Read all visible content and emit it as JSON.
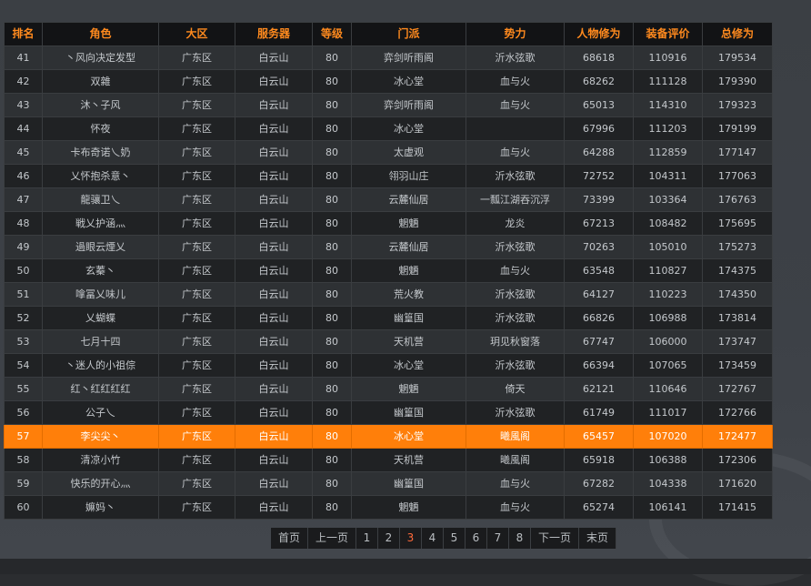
{
  "columns": [
    "排名",
    "角色",
    "大区",
    "服务器",
    "等级",
    "门派",
    "势力",
    "人物修为",
    "装备评价",
    "总修为"
  ],
  "rows": [
    [
      "41",
      "丶风向决定发型",
      "广东区",
      "白云山",
      "80",
      "弈剑听雨阁",
      "沂水弦歌",
      "68618",
      "110916",
      "179534"
    ],
    [
      "42",
      "双雜",
      "广东区",
      "白云山",
      "80",
      "冰心堂",
      "血与火",
      "68262",
      "111128",
      "179390"
    ],
    [
      "43",
      "沐丶子风",
      "广东区",
      "白云山",
      "80",
      "弈剑听雨阁",
      "血与火",
      "65013",
      "114310",
      "179323"
    ],
    [
      "44",
      "怀夜",
      "广东区",
      "白云山",
      "80",
      "冰心堂",
      "",
      "67996",
      "111203",
      "179199"
    ],
    [
      "45",
      "卡布奇诺乀奶",
      "广东区",
      "白云山",
      "80",
      "太虚观",
      "血与火",
      "64288",
      "112859",
      "177147"
    ],
    [
      "46",
      "乂怀抱杀意丶",
      "广东区",
      "白云山",
      "80",
      "翎羽山庄",
      "沂水弦歌",
      "72752",
      "104311",
      "177063"
    ],
    [
      "47",
      "龍骧卫乀",
      "广东区",
      "白云山",
      "80",
      "云麓仙居",
      "一瓢江湖吞沉浮",
      "73399",
      "103364",
      "176763"
    ],
    [
      "48",
      "戦乂护涵灬",
      "广东区",
      "白云山",
      "80",
      "魍魉",
      "龙炎",
      "67213",
      "108482",
      "175695"
    ],
    [
      "49",
      "過眼云煙乂",
      "广东区",
      "白云山",
      "80",
      "云麓仙居",
      "沂水弦歌",
      "70263",
      "105010",
      "175273"
    ],
    [
      "50",
      "玄蓁丶",
      "广东区",
      "白云山",
      "80",
      "魍魉",
      "血与火",
      "63548",
      "110827",
      "174375"
    ],
    [
      "51",
      "嗱冨乂味儿",
      "广东区",
      "白云山",
      "80",
      "荒火教",
      "沂水弦歌",
      "64127",
      "110223",
      "174350"
    ],
    [
      "52",
      "乂蝴蝶",
      "广东区",
      "白云山",
      "80",
      "幽篁国",
      "沂水弦歌",
      "66826",
      "106988",
      "173814"
    ],
    [
      "53",
      "七月十四",
      "广东区",
      "白云山",
      "80",
      "天机营",
      "玥见秋窗落",
      "67747",
      "106000",
      "173747"
    ],
    [
      "54",
      "丶迷人的小祖倧",
      "广东区",
      "白云山",
      "80",
      "冰心堂",
      "沂水弦歌",
      "66394",
      "107065",
      "173459"
    ],
    [
      "55",
      "红丶红红红红",
      "广东区",
      "白云山",
      "80",
      "魍魉",
      "倚天",
      "62121",
      "110646",
      "172767"
    ],
    [
      "56",
      "公子乀",
      "广东区",
      "白云山",
      "80",
      "幽篁国",
      "沂水弦歌",
      "61749",
      "111017",
      "172766"
    ],
    [
      "57",
      "李尖尖丶",
      "广东区",
      "白云山",
      "80",
      "冰心堂",
      "曦風阁",
      "65457",
      "107020",
      "172477"
    ],
    [
      "58",
      "清凉小竹",
      "广东区",
      "白云山",
      "80",
      "天机营",
      "曦風阁",
      "65918",
      "106388",
      "172306"
    ],
    [
      "59",
      "快乐的开心灬",
      "广东区",
      "白云山",
      "80",
      "幽篁国",
      "血与火",
      "67282",
      "104338",
      "171620"
    ],
    [
      "60",
      "嫲妈丶",
      "广东区",
      "白云山",
      "80",
      "魍魉",
      "血与火",
      "65274",
      "106141",
      "171415"
    ]
  ],
  "highlight_rank": "57",
  "pager": {
    "first": "首页",
    "prev": "上一页",
    "pages": [
      "1",
      "2",
      "3",
      "4",
      "5",
      "6",
      "7",
      "8"
    ],
    "current": "3",
    "next": "下一页",
    "last": "末页"
  },
  "colors": {
    "header_text": "#ff8a1e",
    "highlight_row": "#ff7f0a",
    "current_page": "#ff6a3a"
  }
}
